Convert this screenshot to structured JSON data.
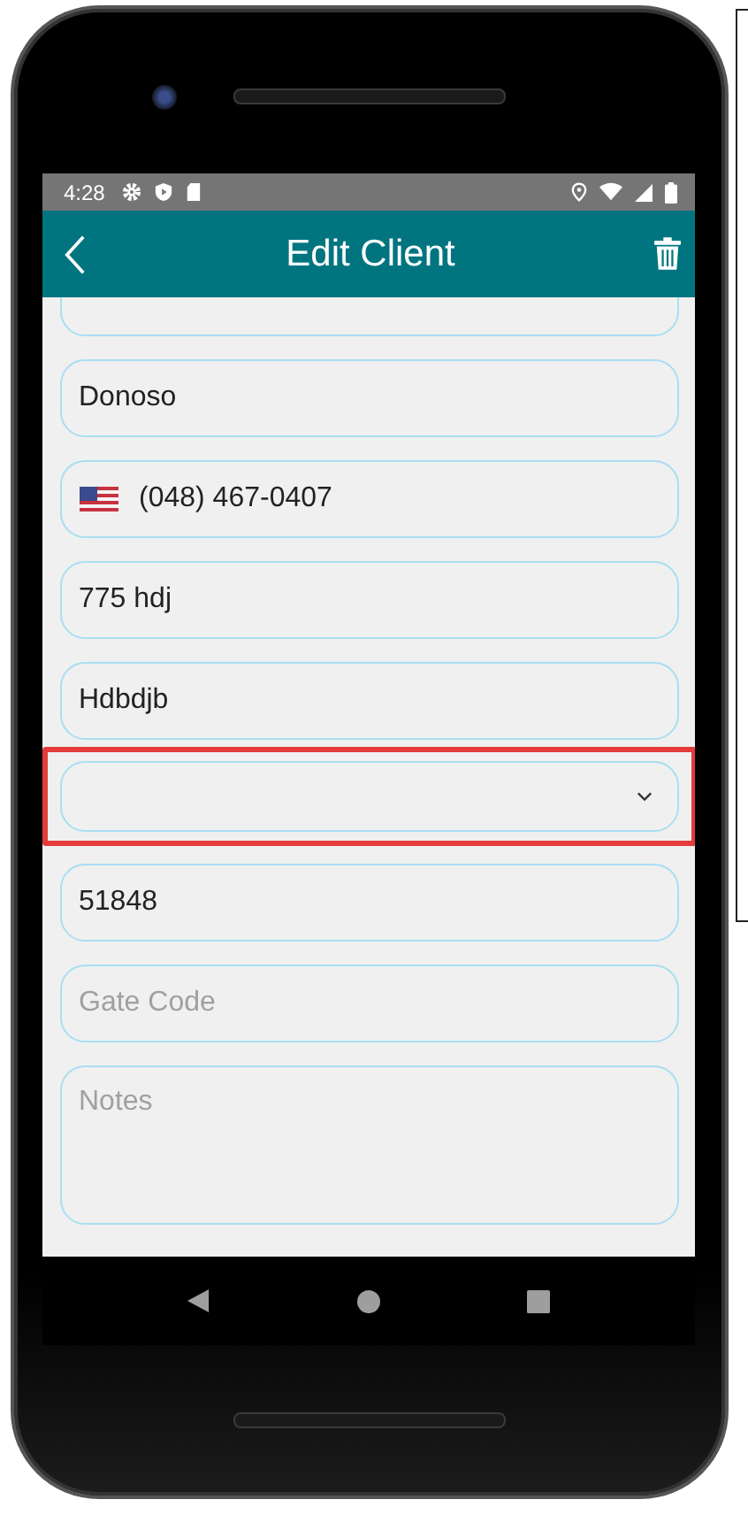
{
  "status_bar": {
    "time": "4:28"
  },
  "app_bar": {
    "title": "Edit Client"
  },
  "fields": [
    {
      "kind": "text",
      "value": "Donoso",
      "highlighted": false
    },
    {
      "kind": "phone",
      "value": "(048) 467-0407",
      "highlighted": false
    },
    {
      "kind": "text",
      "value": "775 hdj",
      "highlighted": false
    },
    {
      "kind": "text",
      "value": "Hdbdjb",
      "highlighted": false
    },
    {
      "kind": "dropdown",
      "highlighted": true
    },
    {
      "kind": "text",
      "value": "51848",
      "highlighted": false
    },
    {
      "kind": "text",
      "placeholder": "Gate Code",
      "highlighted": false
    },
    {
      "kind": "multiline",
      "placeholder": "Notes",
      "highlighted": false
    }
  ]
}
